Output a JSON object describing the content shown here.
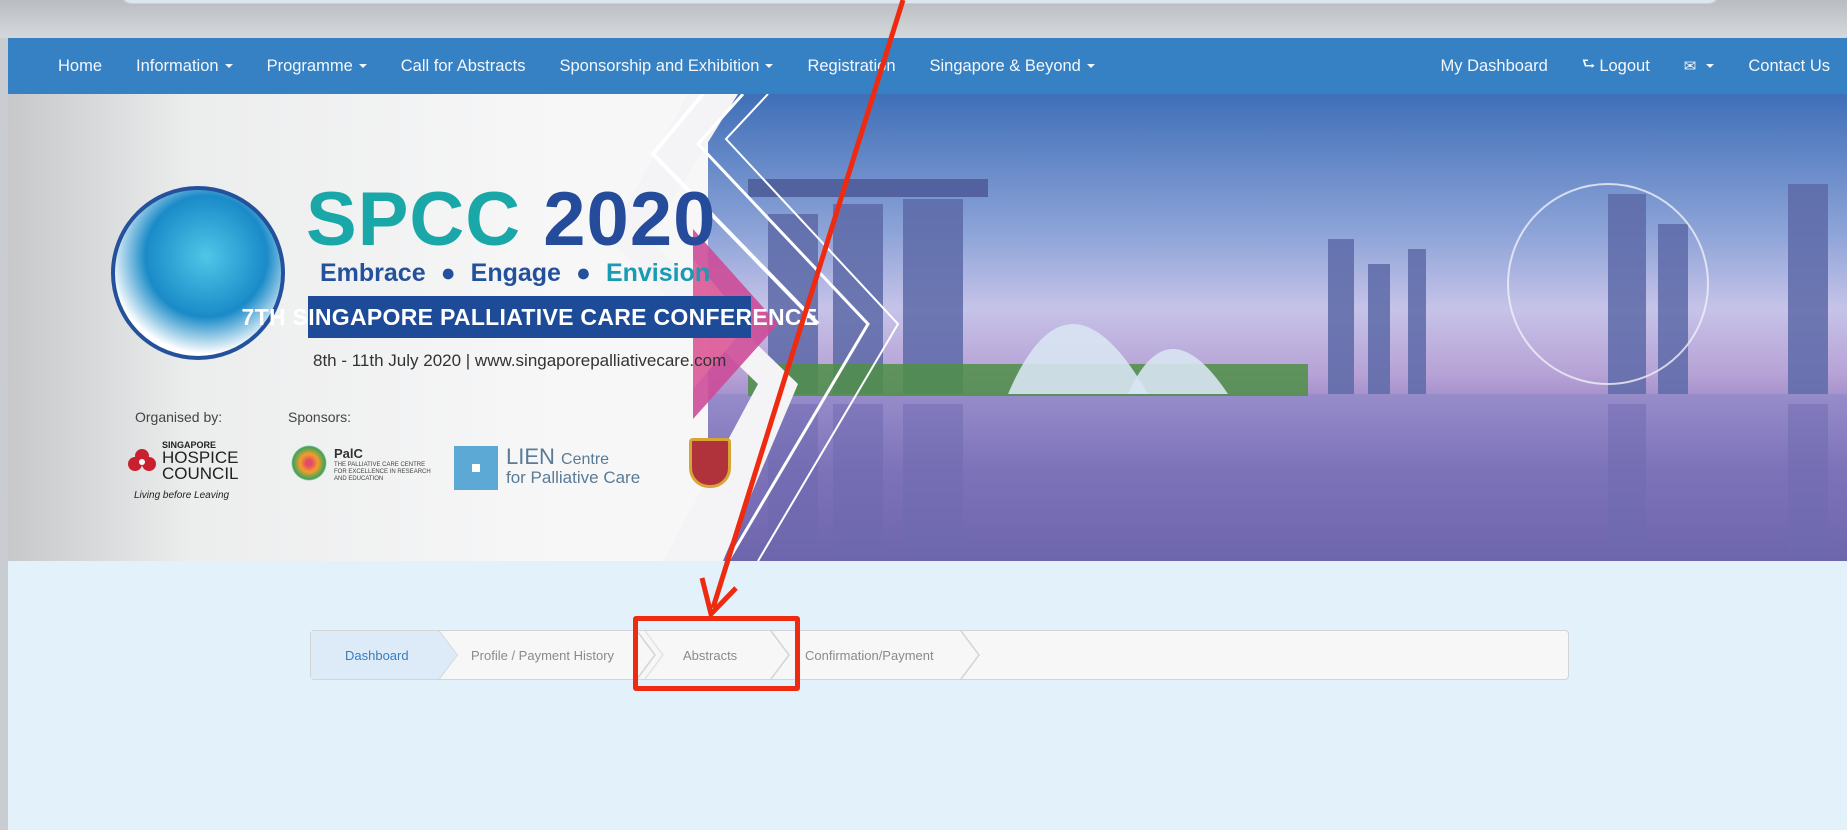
{
  "nav": {
    "left": [
      {
        "label": "Home",
        "caret": false
      },
      {
        "label": "Information",
        "caret": true
      },
      {
        "label": "Programme",
        "caret": true
      },
      {
        "label": "Call for Abstracts",
        "caret": false
      },
      {
        "label": "Sponsorship and Exhibition",
        "caret": true
      },
      {
        "label": "Registration",
        "caret": false
      },
      {
        "label": "Singapore & Beyond",
        "caret": true
      }
    ],
    "right": {
      "dashboard": "My Dashboard",
      "logout": "Logout",
      "logout_icon": "⮑",
      "mail_icon": "✉",
      "contact": "Contact Us"
    }
  },
  "hero": {
    "title_part1": "SPCC",
    "title_part2": "2020",
    "tagline": [
      "Embrace",
      "Engage",
      "Envision"
    ],
    "tagline_bullet": "●",
    "conference": "7TH SINGAPORE PALLIATIVE CARE CONFERENCE",
    "dates": "8th - 11th July 2020  |  www.singaporepalliativecare.com",
    "organised_by": "Organised by:",
    "sponsors": "Sponsors:",
    "shc_small": "SINGAPORE",
    "shc_big1": "HOSPICE",
    "shc_big2": "COUNCIL",
    "shc_motto": "Living before Leaving",
    "palc_name": "PalC",
    "palc_desc": "THE PALLIATIVE CARE CENTRE FOR EXCELLENCE IN RESEARCH AND EDUCATION",
    "lien_line1": "LIEN",
    "lien_line1b": "Centre",
    "lien_line2": "for Palliative Care"
  },
  "wizard": {
    "steps": [
      "Dashboard",
      "Profile / Payment History",
      "Abstracts",
      "Confirmation/Payment"
    ],
    "active_index": 0
  },
  "colors": {
    "navbar": "#3681c3",
    "page_bg": "#e2f1fa",
    "annotation": "#ee2b10"
  }
}
